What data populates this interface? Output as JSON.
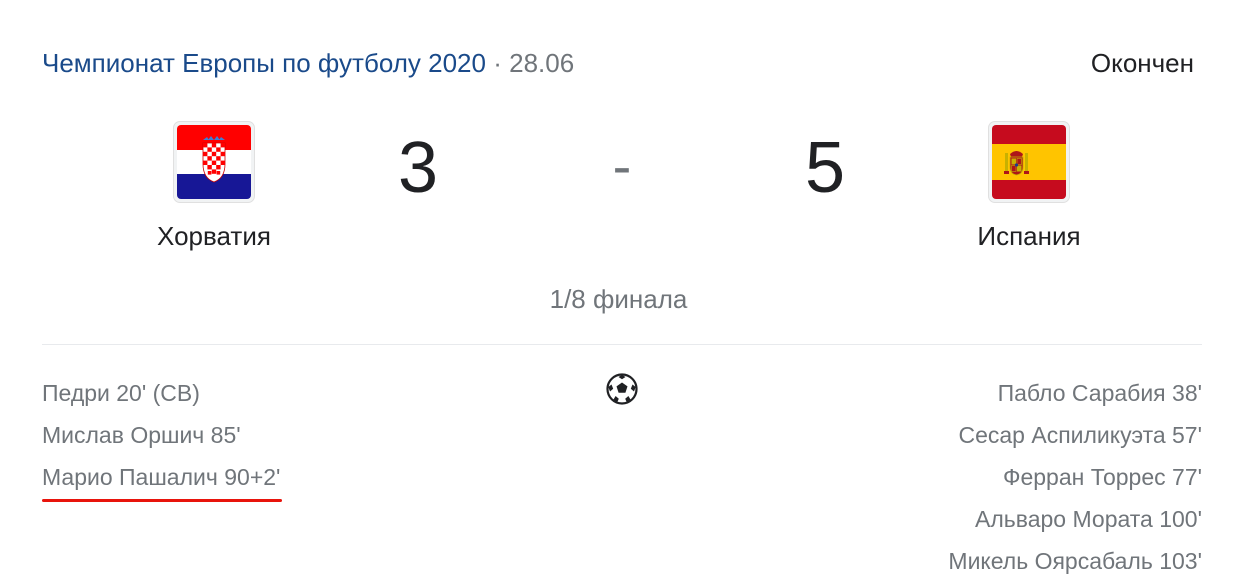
{
  "header": {
    "tournament": "Чемпионат Европы по футболу 2020",
    "separator": "·",
    "date": "28.06",
    "status": "Окончен"
  },
  "home": {
    "name": "Хорватия",
    "score": "3",
    "flag_icon": "croatia-flag-icon",
    "goals": [
      "Педри 20' (СВ)",
      "Мислав Оршич 85'",
      "Марио Пашалич 90+2'"
    ]
  },
  "away": {
    "name": "Испания",
    "score": "5",
    "flag_icon": "spain-flag-icon",
    "goals": [
      "Пабло Сарабия 38'",
      "Сесар Аспиликуэта 57'",
      "Ферран Торрес 77'",
      "Альваро Мората 100'",
      "Микель Оярсабаль 103'"
    ]
  },
  "score_separator": "-",
  "stage": "1/8 финала",
  "colors": {
    "link": "#1a4a8a",
    "muted": "#70757a",
    "text": "#202124",
    "highlight_underline": "#e8140c"
  }
}
